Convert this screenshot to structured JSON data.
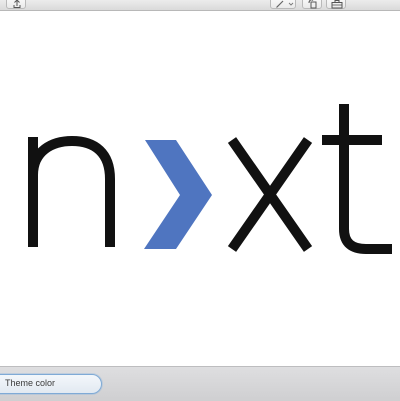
{
  "toolbar": {
    "buttons": [
      {
        "name": "share-button",
        "icon": "share-icon"
      },
      {
        "name": "markup-pen-button",
        "icon": "pen-icon"
      },
      {
        "name": "rotate-button",
        "icon": "rotate-icon"
      },
      {
        "name": "toolbox-button",
        "icon": "toolbox-icon"
      }
    ]
  },
  "logo": {
    "letters": [
      "n",
      "x",
      "t"
    ],
    "text_color": "#111111",
    "accent_color": "#4f75c0",
    "icon": "chevron-right-icon"
  },
  "bottom_panel": {
    "theme_color_label": "Theme color"
  }
}
